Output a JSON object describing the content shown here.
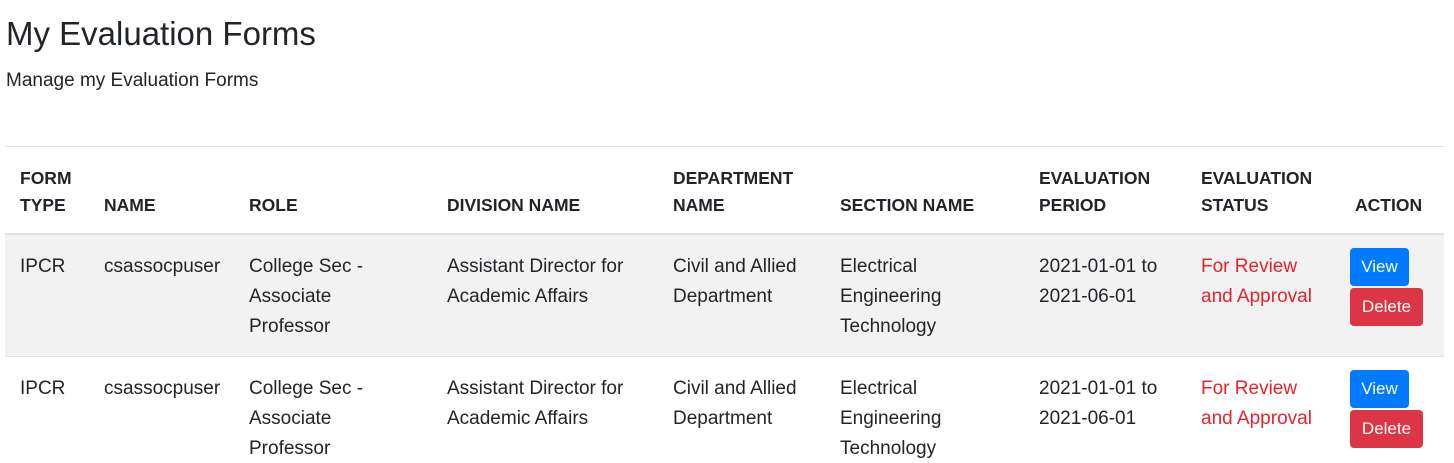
{
  "page": {
    "title": "My Evaluation Forms",
    "subtitle": "Manage my Evaluation Forms"
  },
  "table": {
    "headers": {
      "form_type": [
        "FORM",
        "TYPE"
      ],
      "name": "NAME",
      "role": "ROLE",
      "division_name": "DIVISION NAME",
      "department_name": [
        "DEPARTMENT",
        "NAME"
      ],
      "section_name": "SECTION NAME",
      "evaluation_period": [
        "EVALUATION",
        "PERIOD"
      ],
      "evaluation_status": [
        "EVALUATION",
        "STATUS"
      ],
      "action": "ACTION"
    },
    "rows": [
      {
        "form_type": "IPCR",
        "name": "csassocpuser",
        "role": [
          "College Sec -",
          "Associate",
          "Professor"
        ],
        "division_name": [
          "Assistant Director for",
          "Academic Affairs"
        ],
        "department_name": [
          "Civil and Allied",
          "Department"
        ],
        "section_name": [
          "Electrical",
          "Engineering",
          "Technology"
        ],
        "evaluation_period": [
          "2021-01-01 to",
          "2021-06-01"
        ],
        "evaluation_status": [
          "For Review",
          "and Approval"
        ],
        "view_label": "View",
        "delete_label": "Delete"
      },
      {
        "form_type": "IPCR",
        "name": "csassocpuser",
        "role": [
          "College Sec -",
          "Associate",
          "Professor"
        ],
        "division_name": [
          "Assistant Director for",
          "Academic Affairs"
        ],
        "department_name": [
          "Civil and Allied",
          "Department"
        ],
        "section_name": [
          "Electrical",
          "Engineering",
          "Technology"
        ],
        "evaluation_period": [
          "2021-01-01 to",
          "2021-06-01"
        ],
        "evaluation_status": [
          "For Review",
          "and Approval"
        ],
        "view_label": "View",
        "delete_label": "Delete"
      }
    ]
  },
  "colors": {
    "status_text": "#e8222b",
    "view_button": "#007bff",
    "delete_button": "#dc3545",
    "striped_row": "#f2f2f2"
  }
}
